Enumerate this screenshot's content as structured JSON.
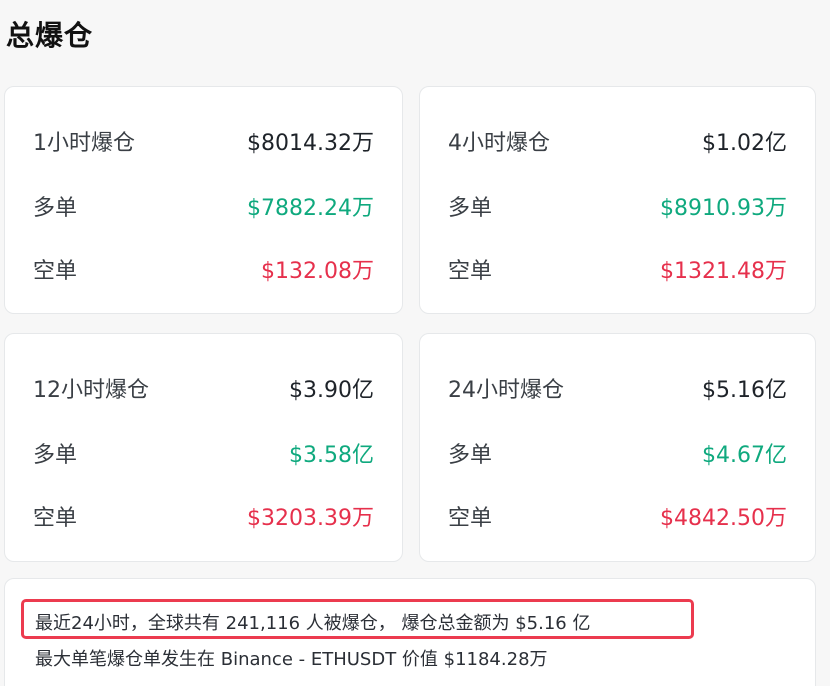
{
  "page": {
    "title": "总爆仓"
  },
  "cards": [
    {
      "period": "1小时爆仓",
      "total": "$8014.32万",
      "long_label": "多单",
      "long_value": "$7882.24万",
      "short_label": "空单",
      "short_value": "$132.08万"
    },
    {
      "period": "4小时爆仓",
      "total": "$1.02亿",
      "long_label": "多单",
      "long_value": "$8910.93万",
      "short_label": "空单",
      "short_value": "$1321.48万"
    },
    {
      "period": "12小时爆仓",
      "total": "$3.90亿",
      "long_label": "多单",
      "long_value": "$3.58亿",
      "short_label": "空单",
      "short_value": "$3203.39万"
    },
    {
      "period": "24小时爆仓",
      "total": "$5.16亿",
      "long_label": "多单",
      "long_value": "$4.67亿",
      "short_label": "空单",
      "short_value": "$4842.50万"
    }
  ],
  "summary": {
    "line1": "最近24小时，全球共有 241,116 人被爆仓， 爆仓总金额为 $5.16 亿",
    "line2": "最大单笔爆仓单发生在 Binance - ETHUSDT 价值 $1184.28万"
  },
  "colors": {
    "long": "#0fa97e",
    "short": "#e6304c",
    "highlight_border": "#ec3b4f"
  }
}
